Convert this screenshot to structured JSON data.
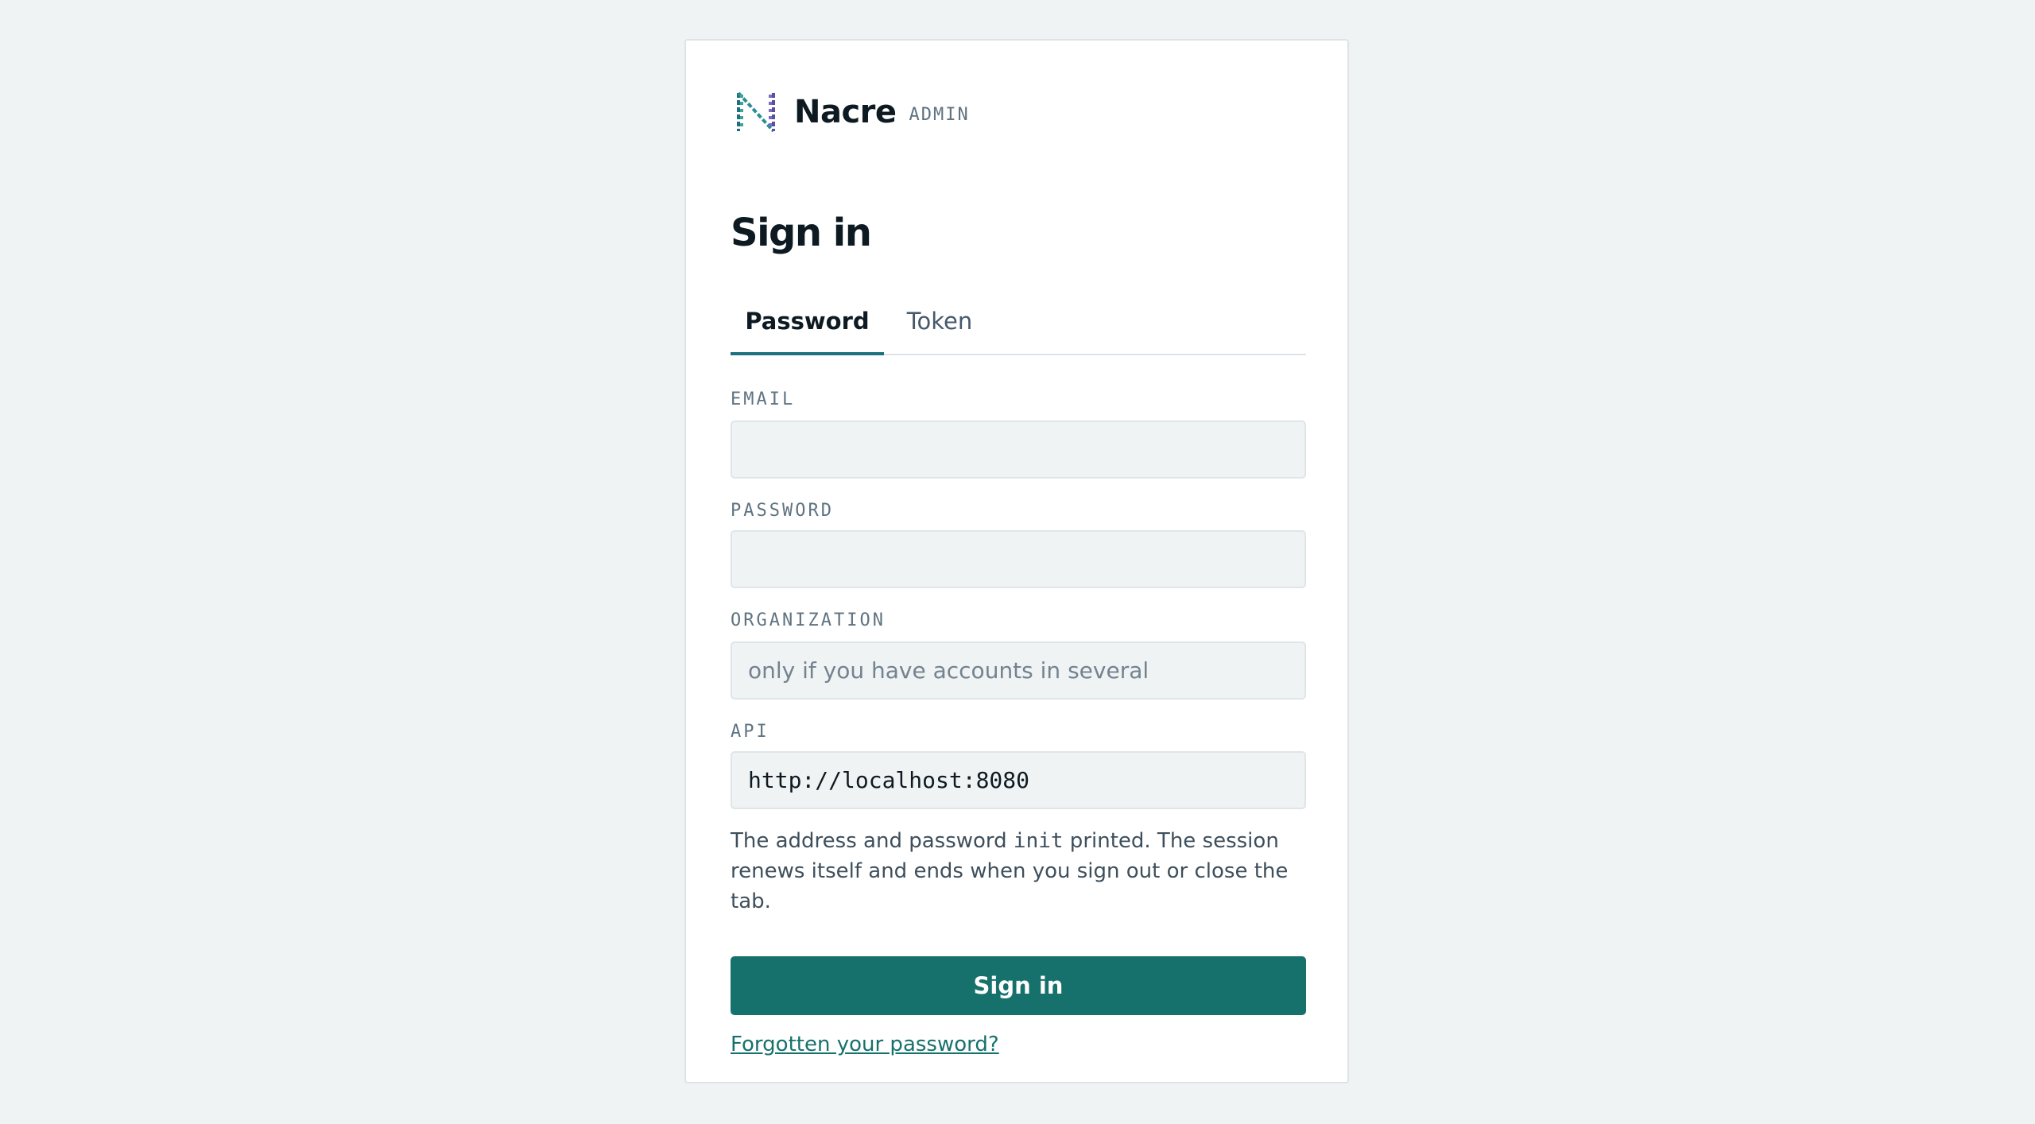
{
  "brand": {
    "name": "Nacre",
    "tag": "ADMIN",
    "logo_icon": "nacre-n-logo-icon"
  },
  "page": {
    "title": "Sign in"
  },
  "tabs": [
    {
      "label": "Password",
      "active": true
    },
    {
      "label": "Token",
      "active": false
    }
  ],
  "form": {
    "email": {
      "label": "EMAIL",
      "value": "",
      "placeholder": ""
    },
    "password": {
      "label": "PASSWORD",
      "value": "",
      "placeholder": ""
    },
    "organization": {
      "label": "ORGANIZATION",
      "value": "",
      "placeholder": "only if you have accounts in several"
    },
    "api": {
      "label": "API",
      "value": "http://localhost:8080",
      "placeholder": ""
    }
  },
  "help": {
    "before": "The address and password ",
    "code": "init",
    "after": " printed. The session renews itself and ends when you sign out or close the tab."
  },
  "actions": {
    "submit_label": "Sign in",
    "forgot_label": "Forgotten your password?"
  },
  "colors": {
    "background": "#f0f3f4",
    "accent": "#16716d",
    "tab_underline": "#1b7180",
    "text": "#0e1a22",
    "muted": "#5f7380"
  }
}
